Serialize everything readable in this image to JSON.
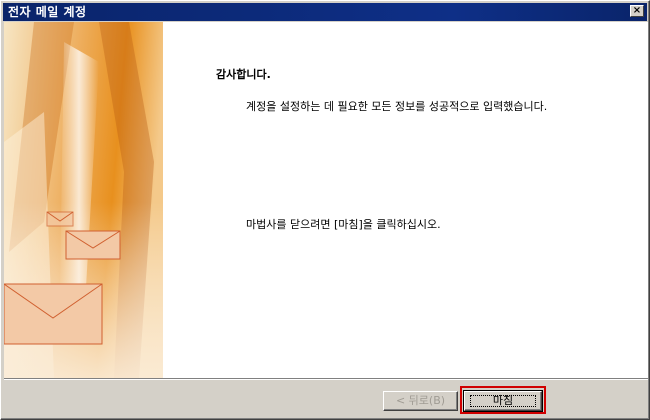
{
  "window": {
    "title": "전자 메일 계정"
  },
  "content": {
    "heading": "감사합니다.",
    "message": "계정을 설정하는 데 필요한 모든 정보를 성공적으로 입력했습니다.",
    "instruction": "마법사를 닫으려면 [마침]을 클릭하십시오."
  },
  "buttons": {
    "back_label": "< 뒤로(B)",
    "finish_label": "마침",
    "close_glyph": "×"
  },
  "colors": {
    "titlebar": "#0a246a",
    "highlight": "#d00000",
    "art_orange": "#e8901e"
  }
}
